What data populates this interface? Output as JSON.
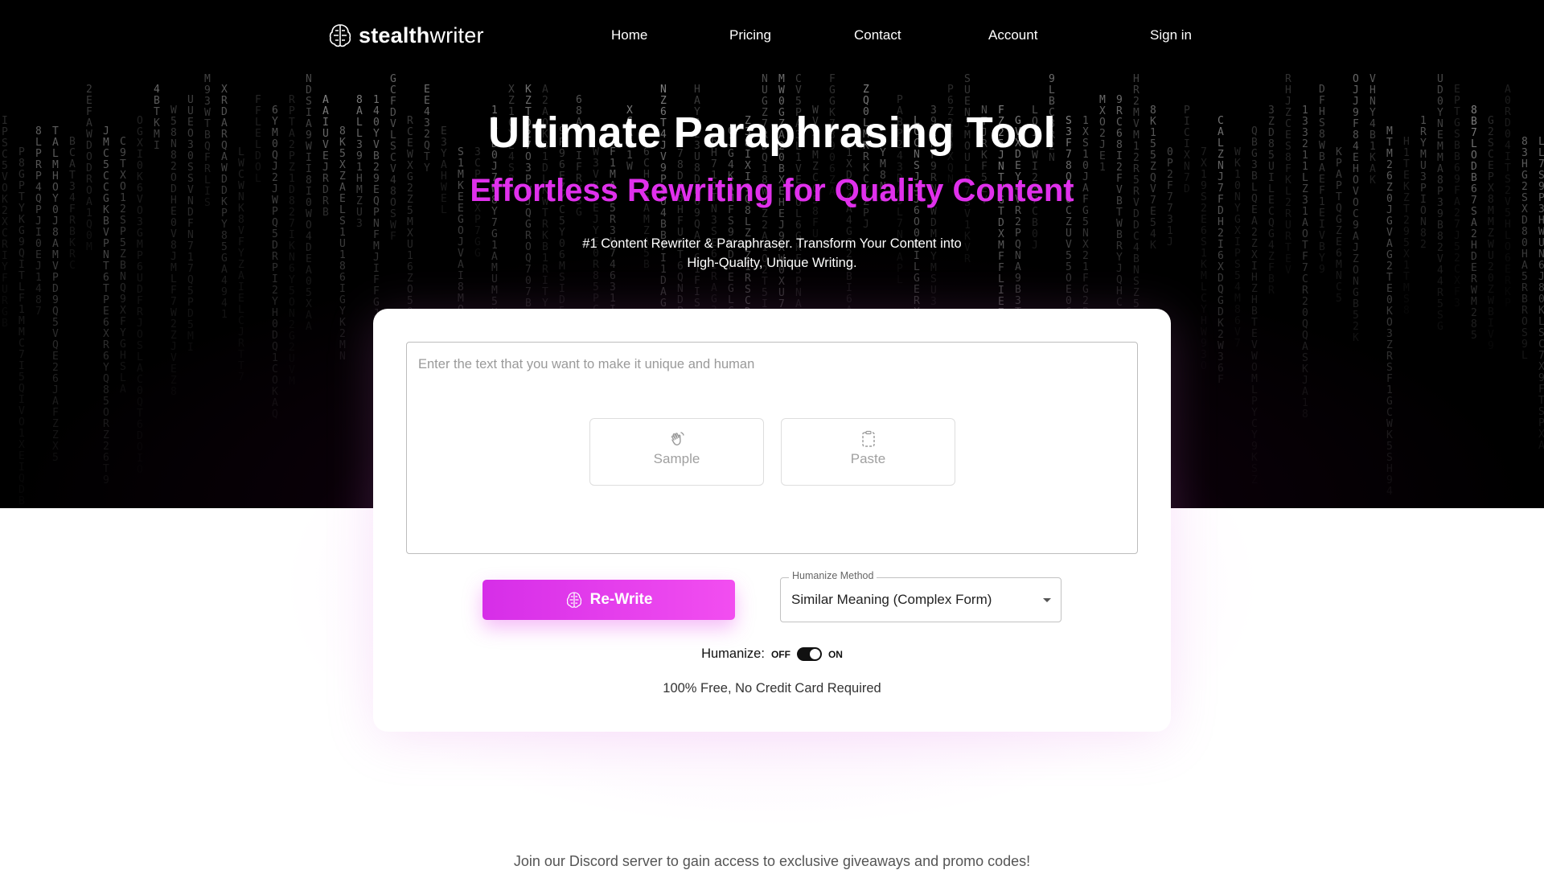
{
  "nav": {
    "logo_bold": "stealth",
    "logo_light": "writer",
    "links": [
      "Home",
      "Pricing",
      "Contact",
      "Account"
    ],
    "signin": "Sign in"
  },
  "hero": {
    "title": "Ultimate Paraphrasing Tool",
    "subtitle": "Effortless Rewriting for Quality Content",
    "desc_line1": "#1 Content Rewriter & Paraphraser. Transform Your Content into",
    "desc_line2": "High-Quality, Unique Writing."
  },
  "editor": {
    "placeholder": "Enter the text that you want to make it unique and human",
    "sample_label": "Sample",
    "paste_label": "Paste"
  },
  "actions": {
    "rewrite_label": "Re-Write",
    "method_legend": "Humanize Method",
    "method_value": "Similar Meaning (Complex Form)",
    "humanize_label": "Humanize:",
    "off_label": "OFF",
    "on_label": "ON",
    "humanize_on": true,
    "free_note": "100% Free, No Credit Card Required"
  },
  "footer": {
    "discord_text": "Join our Discord server to gain access to exclusive giveaways and promo codes!"
  },
  "colors": {
    "accent": "#e030ec",
    "hero_bg": "#000000",
    "button_gradient_start": "#d62ee8",
    "button_gradient_end": "#f24ef0"
  }
}
